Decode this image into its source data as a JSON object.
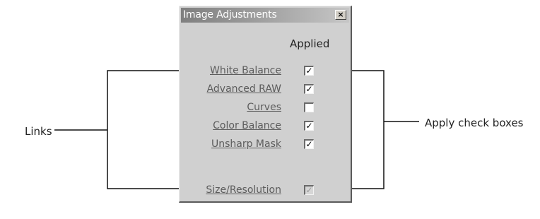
{
  "callouts": {
    "links": "Links",
    "apply": "Apply check boxes"
  },
  "window": {
    "title": "Image Adjustments",
    "close_glyph": "×",
    "applied_header": "Applied"
  },
  "rows": [
    {
      "label": "White Balance",
      "checked": true,
      "disabled": false
    },
    {
      "label": "Advanced RAW",
      "checked": true,
      "disabled": false
    },
    {
      "label": "Curves",
      "checked": false,
      "disabled": false
    },
    {
      "label": "Color Balance",
      "checked": true,
      "disabled": false
    },
    {
      "label": "Unsharp Mask",
      "checked": true,
      "disabled": false
    },
    {
      "label": "Size/Resolution",
      "checked": true,
      "disabled": true
    }
  ],
  "check_glyph": "✓"
}
